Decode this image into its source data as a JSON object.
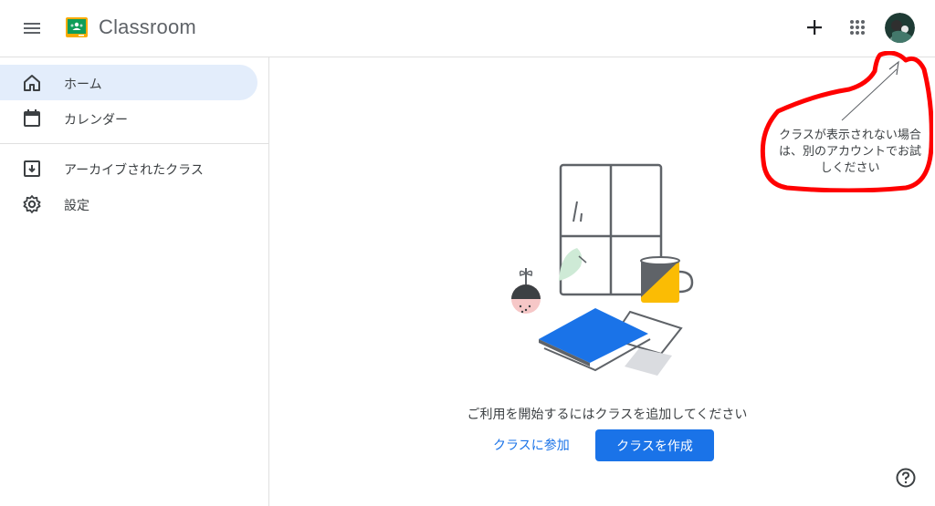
{
  "header": {
    "app_title": "Classroom",
    "menu_icon": "hamburger-menu-icon",
    "logo_icon": "classroom-logo-icon",
    "add_icon": "plus-icon",
    "apps_icon": "apps-grid-icon",
    "avatar_icon": "account-avatar"
  },
  "sidebar": {
    "items": [
      {
        "label": "ホーム",
        "icon": "home-icon",
        "active": true
      },
      {
        "label": "カレンダー",
        "icon": "calendar-icon",
        "active": false
      },
      {
        "label": "アーカイブされたクラス",
        "icon": "archive-icon",
        "active": false
      },
      {
        "label": "設定",
        "icon": "gear-icon",
        "active": false
      }
    ]
  },
  "annotation": {
    "line1": "クラスが表示されない場合",
    "line2": "は、別のアカウントでお試",
    "line3": "しください",
    "color": "#ff0000"
  },
  "main": {
    "empty_message": "ご利用を開始するにはクラスを追加してください",
    "join_label": "クラスに参加",
    "create_label": "クラスを作成"
  },
  "colors": {
    "accent": "#1a73e8",
    "active_nav_bg": "#e3edfb"
  }
}
